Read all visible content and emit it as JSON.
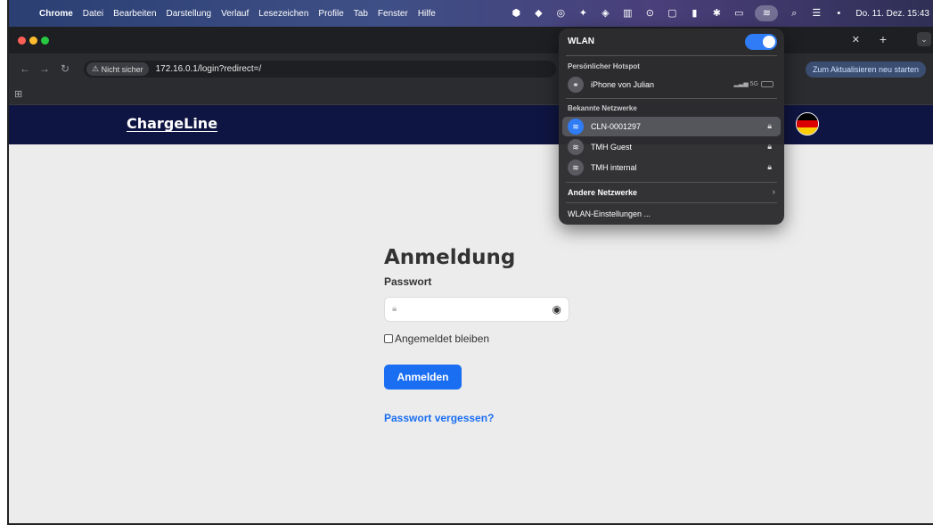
{
  "menubar": {
    "app_name": "Chrome",
    "items": [
      "Datei",
      "Bearbeiten",
      "Darstellung",
      "Verlauf",
      "Lesezeichen",
      "Profile",
      "Tab",
      "Fenster",
      "Hilfe"
    ],
    "clock": "Do. 11. Dez. 15:43"
  },
  "browser": {
    "security_label": "Nicht sicher",
    "url": "172.16.0.1/login?redirect=/",
    "update_button": "Zum Aktualisieren neu starten"
  },
  "site": {
    "logo": "ChargeLine"
  },
  "login": {
    "title": "Anmeldung",
    "password_label": "Passwort",
    "password_value": "",
    "remember_label": "Angemeldet bleiben",
    "submit_label": "Anmelden",
    "forgot_link": "Passwort vergessen?"
  },
  "wlan_menu": {
    "title": "WLAN",
    "enabled": true,
    "hotspot_section": "Persönlicher Hotspot",
    "hotspot": {
      "name": "iPhone von Julian",
      "band": "5G"
    },
    "known_section": "Bekannte Netzwerke",
    "known_networks": [
      {
        "name": "CLN-0001297",
        "connected": true
      },
      {
        "name": "TMH Guest",
        "connected": false
      },
      {
        "name": "TMH internal",
        "connected": false
      }
    ],
    "other_networks": "Andere Netzwerke",
    "settings": "WLAN-Einstellungen ..."
  },
  "colors": {
    "header_bg": "#0f1542",
    "accent": "#1a6ef2",
    "toggle": "#2f7cf6"
  }
}
